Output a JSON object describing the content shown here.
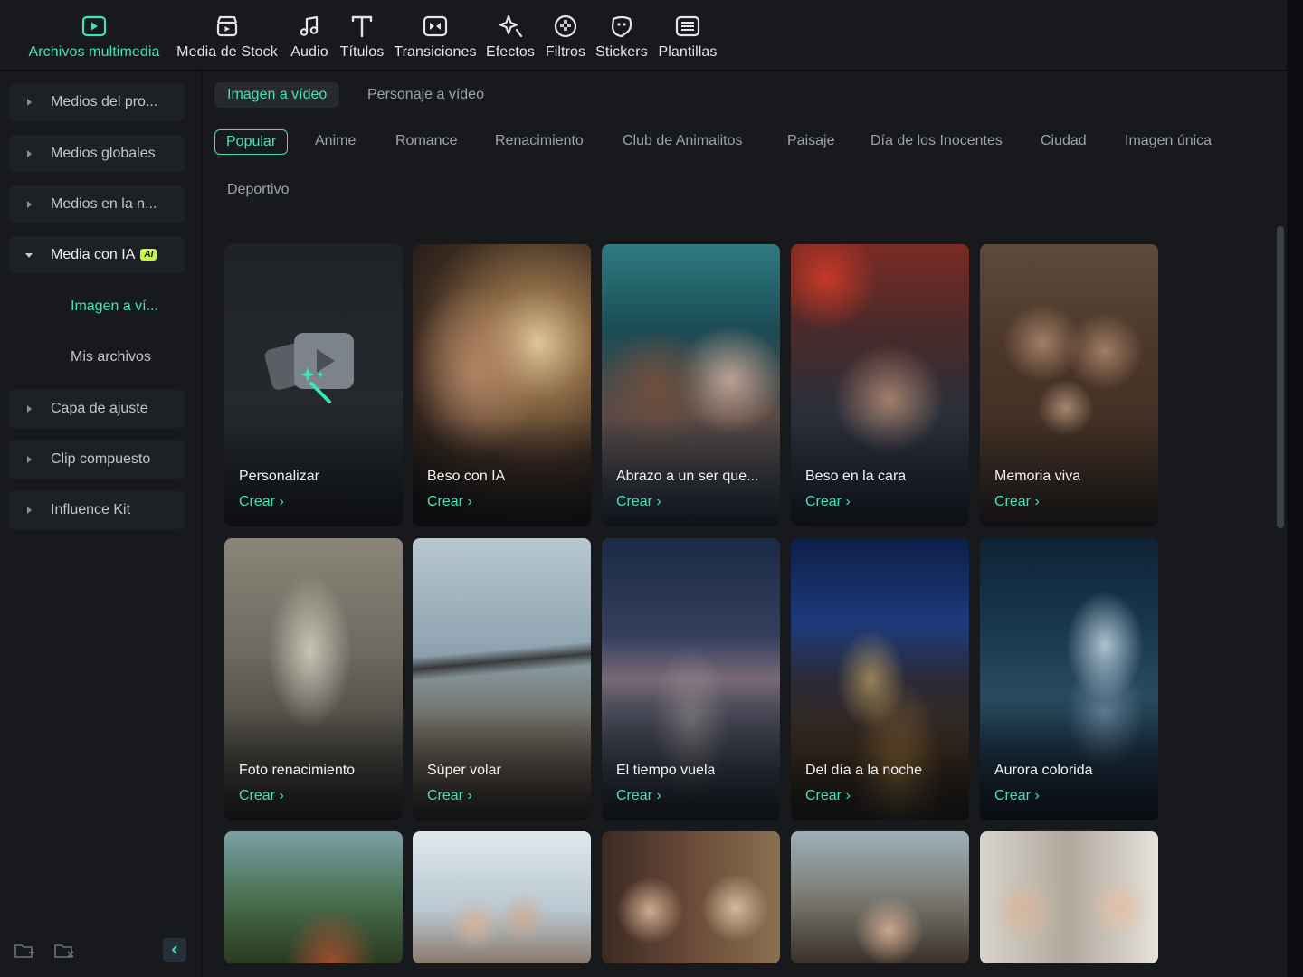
{
  "toolbar": {
    "items": [
      {
        "label": "Archivos multimedia",
        "icon": "media-folder-icon",
        "active": true
      },
      {
        "label": "Media de Stock",
        "icon": "stock-store-icon"
      },
      {
        "label": "Audio",
        "icon": "music-note-icon"
      },
      {
        "label": "Títulos",
        "icon": "title-t-icon"
      },
      {
        "label": "Transiciones",
        "icon": "transition-icon"
      },
      {
        "label": "Efectos",
        "icon": "effects-sparkle-icon"
      },
      {
        "label": "Filtros",
        "icon": "filter-icon"
      },
      {
        "label": "Stickers",
        "icon": "sticker-icon"
      },
      {
        "label": "Plantillas",
        "icon": "template-icon"
      }
    ]
  },
  "sidebar": {
    "items": [
      {
        "label": "Medios del pro..."
      },
      {
        "label": "Medios globales"
      },
      {
        "label": "Medios en la n..."
      },
      {
        "label": "Media con IA",
        "badge": "AI",
        "expanded": true
      },
      {
        "label": "Capa de ajuste"
      },
      {
        "label": "Clip compuesto"
      },
      {
        "label": "Influence Kit"
      }
    ],
    "subitems": [
      {
        "label": "Imagen a ví...",
        "active": true
      },
      {
        "label": "Mis archivos"
      }
    ]
  },
  "tabs": [
    {
      "label": "Imagen a vídeo",
      "active": true
    },
    {
      "label": "Personaje a vídeo"
    }
  ],
  "categories": [
    "Popular",
    "Anime",
    "Romance",
    "Renacimiento",
    "Club de Animalitos",
    "Paisaje",
    "Día de los Inocentes",
    "Ciudad",
    "Imagen única",
    "Deportivo"
  ],
  "active_category": "Popular",
  "cta_label": "Crear",
  "cards": [
    {
      "title": "Personalizar"
    },
    {
      "title": "Beso con IA"
    },
    {
      "title": "Abrazo a un ser que..."
    },
    {
      "title": "Beso en la cara"
    },
    {
      "title": "Memoria viva"
    },
    {
      "title": "Foto renacimiento"
    },
    {
      "title": "Súper volar"
    },
    {
      "title": "El tiempo vuela"
    },
    {
      "title": "Del día a la noche"
    },
    {
      "title": "Aurora colorida"
    }
  ],
  "colors": {
    "accent": "#40e3b8",
    "background": "#17191d",
    "ai_badge": "#c6f34a"
  }
}
